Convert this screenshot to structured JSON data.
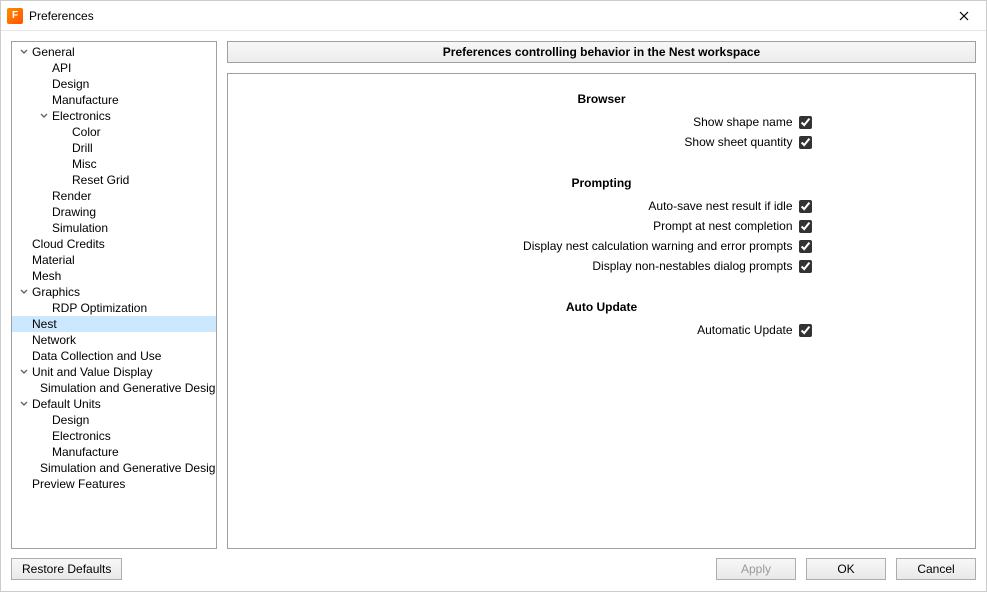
{
  "window": {
    "title": "Preferences"
  },
  "tree": [
    {
      "label": "General",
      "level": 0,
      "expandable": true,
      "expanded": true
    },
    {
      "label": "API",
      "level": 1,
      "expandable": false
    },
    {
      "label": "Design",
      "level": 1,
      "expandable": false
    },
    {
      "label": "Manufacture",
      "level": 1,
      "expandable": false
    },
    {
      "label": "Electronics",
      "level": 1,
      "expandable": true,
      "expanded": true
    },
    {
      "label": "Color",
      "level": 2,
      "expandable": false
    },
    {
      "label": "Drill",
      "level": 2,
      "expandable": false
    },
    {
      "label": "Misc",
      "level": 2,
      "expandable": false
    },
    {
      "label": "Reset Grid",
      "level": 2,
      "expandable": false
    },
    {
      "label": "Render",
      "level": 1,
      "expandable": false
    },
    {
      "label": "Drawing",
      "level": 1,
      "expandable": false
    },
    {
      "label": "Simulation",
      "level": 1,
      "expandable": false
    },
    {
      "label": "Cloud Credits",
      "level": 0,
      "expandable": false
    },
    {
      "label": "Material",
      "level": 0,
      "expandable": false
    },
    {
      "label": "Mesh",
      "level": 0,
      "expandable": false
    },
    {
      "label": "Graphics",
      "level": 0,
      "expandable": true,
      "expanded": true
    },
    {
      "label": "RDP Optimization",
      "level": 1,
      "expandable": false
    },
    {
      "label": "Nest",
      "level": 0,
      "expandable": false,
      "selected": true
    },
    {
      "label": "Network",
      "level": 0,
      "expandable": false
    },
    {
      "label": "Data Collection and Use",
      "level": 0,
      "expandable": false
    },
    {
      "label": "Unit and Value Display",
      "level": 0,
      "expandable": true,
      "expanded": true
    },
    {
      "label": "Simulation and Generative Design",
      "level": 1,
      "expandable": false
    },
    {
      "label": "Default Units",
      "level": 0,
      "expandable": true,
      "expanded": true
    },
    {
      "label": "Design",
      "level": 1,
      "expandable": false
    },
    {
      "label": "Electronics",
      "level": 1,
      "expandable": false
    },
    {
      "label": "Manufacture",
      "level": 1,
      "expandable": false
    },
    {
      "label": "Simulation and Generative Design",
      "level": 1,
      "expandable": false
    },
    {
      "label": "Preview Features",
      "level": 0,
      "expandable": false
    }
  ],
  "banner": "Preferences controlling behavior in the Nest workspace",
  "sections": [
    {
      "title": "Browser",
      "options": [
        {
          "label": "Show shape name",
          "checked": true
        },
        {
          "label": "Show sheet quantity",
          "checked": true
        }
      ]
    },
    {
      "title": "Prompting",
      "options": [
        {
          "label": "Auto-save nest result if idle",
          "checked": true
        },
        {
          "label": "Prompt at nest completion",
          "checked": true
        },
        {
          "label": "Display nest calculation warning and error prompts",
          "checked": true
        },
        {
          "label": "Display non-nestables dialog prompts",
          "checked": true
        }
      ]
    },
    {
      "title": "Auto Update",
      "options": [
        {
          "label": "Automatic Update",
          "checked": true
        }
      ]
    }
  ],
  "buttons": {
    "restore": "Restore Defaults",
    "apply": "Apply",
    "ok": "OK",
    "cancel": "Cancel"
  }
}
